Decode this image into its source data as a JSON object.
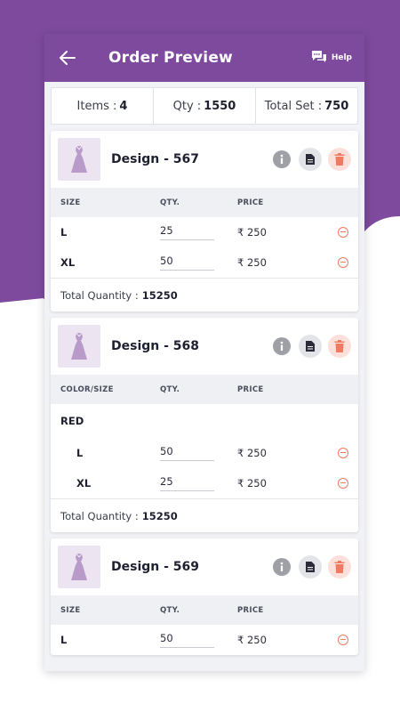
{
  "header": {
    "title": "Order Preview",
    "help_label": "Help"
  },
  "summary": {
    "items_label": "Items :",
    "items_value": "4",
    "qty_label": "Qty :",
    "qty_value": "1550",
    "set_label": "Total Set :",
    "set_value": "750"
  },
  "colors": {
    "brand": "#7e4a9e",
    "delete": "#f07b60"
  },
  "cards": [
    {
      "name": "Design - 567",
      "col1": "SIZE",
      "col2": "QTY.",
      "col3": "PRICE",
      "rows": [
        {
          "size": "L",
          "qty": "25",
          "price": "₹ 250"
        },
        {
          "size": "XL",
          "qty": "50",
          "price": "₹ 250"
        }
      ],
      "total_label": "Total Quantity :",
      "total_value": "15250"
    },
    {
      "name": "Design - 568",
      "col1": "COLOR/SIZE",
      "col2": "QTY.",
      "col3": "PRICE",
      "color": "RED",
      "rows": [
        {
          "size": "L",
          "qty": "50",
          "price": "₹ 250"
        },
        {
          "size": "XL",
          "qty": "25",
          "price": "₹ 250"
        }
      ],
      "total_label": "Total Quantity :",
      "total_value": "15250"
    },
    {
      "name": "Design - 569",
      "col1": "SIZE",
      "col2": "QTY.",
      "col3": "PRICE",
      "rows": [
        {
          "size": "L",
          "qty": "50",
          "price": "₹ 250"
        }
      ]
    }
  ]
}
